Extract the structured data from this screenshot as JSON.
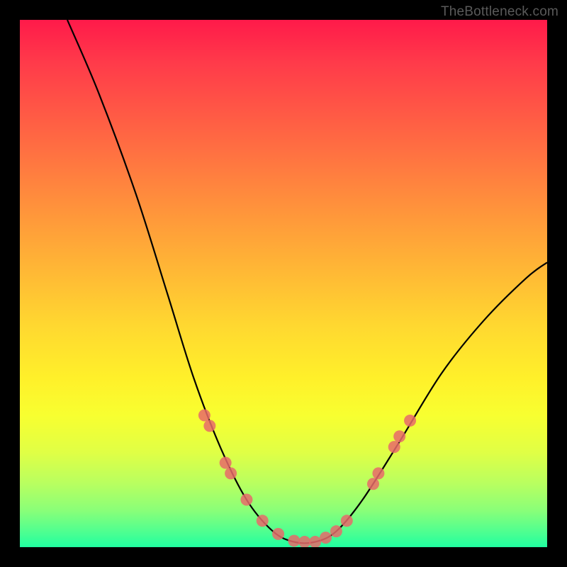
{
  "watermark": "TheBottleneck.com",
  "chart_data": {
    "type": "line",
    "title": "",
    "xlabel": "",
    "ylabel": "",
    "xlim": [
      0,
      100
    ],
    "ylim": [
      0,
      100
    ],
    "curve": {
      "name": "bottleneck-curve",
      "points": [
        {
          "x": 9,
          "y": 100
        },
        {
          "x": 15,
          "y": 86
        },
        {
          "x": 22,
          "y": 67
        },
        {
          "x": 28,
          "y": 48
        },
        {
          "x": 33,
          "y": 32
        },
        {
          "x": 38,
          "y": 19
        },
        {
          "x": 43,
          "y": 9
        },
        {
          "x": 48,
          "y": 3
        },
        {
          "x": 52,
          "y": 1
        },
        {
          "x": 56,
          "y": 1
        },
        {
          "x": 60,
          "y": 3
        },
        {
          "x": 65,
          "y": 9
        },
        {
          "x": 72,
          "y": 20
        },
        {
          "x": 80,
          "y": 33
        },
        {
          "x": 88,
          "y": 43
        },
        {
          "x": 96,
          "y": 51
        },
        {
          "x": 100,
          "y": 54
        }
      ]
    },
    "markers": {
      "name": "highlight-dots",
      "color": "#e86a6a",
      "points": [
        {
          "x": 35,
          "y": 25
        },
        {
          "x": 36,
          "y": 23
        },
        {
          "x": 39,
          "y": 16
        },
        {
          "x": 40,
          "y": 14
        },
        {
          "x": 43,
          "y": 9
        },
        {
          "x": 46,
          "y": 5
        },
        {
          "x": 49,
          "y": 2.5
        },
        {
          "x": 52,
          "y": 1.2
        },
        {
          "x": 54,
          "y": 1
        },
        {
          "x": 56,
          "y": 1
        },
        {
          "x": 58,
          "y": 1.8
        },
        {
          "x": 60,
          "y": 3
        },
        {
          "x": 62,
          "y": 5
        },
        {
          "x": 67,
          "y": 12
        },
        {
          "x": 68,
          "y": 14
        },
        {
          "x": 71,
          "y": 19
        },
        {
          "x": 72,
          "y": 21
        },
        {
          "x": 74,
          "y": 24
        }
      ]
    }
  }
}
